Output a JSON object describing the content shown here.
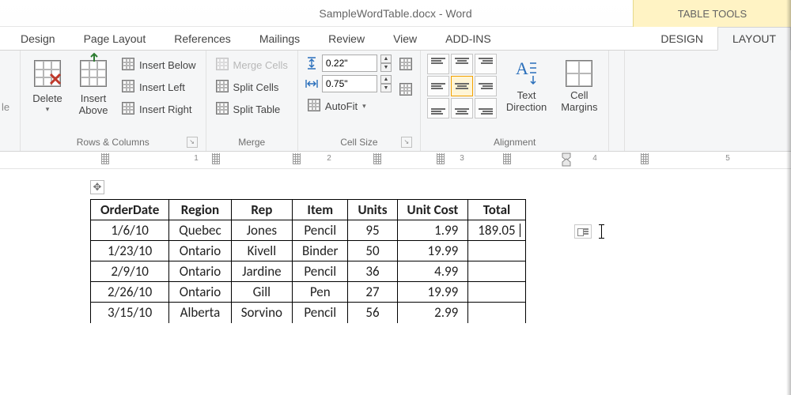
{
  "window": {
    "title": "SampleWordTable.docx - Word",
    "context_tool": "TABLE TOOLS"
  },
  "tabs": {
    "design": "Design",
    "page_layout": "Page Layout",
    "references": "References",
    "mailings": "Mailings",
    "review": "Review",
    "view": "View",
    "addins": "ADD-INS",
    "ctx_design": "DESIGN",
    "ctx_layout": "LAYOUT"
  },
  "ribbon": {
    "delete": "Delete",
    "insert_above": "Insert\nAbove",
    "insert_below": "Insert Below",
    "insert_left": "Insert Left",
    "insert_right": "Insert Right",
    "merge_cells": "Merge Cells",
    "split_cells": "Split Cells",
    "split_table": "Split Table",
    "autofit": "AutoFit",
    "text_direction": "Text\nDirection",
    "cell_margins": "Cell\nMargins",
    "group_rows_cols": "Rows & Columns",
    "group_merge": "Merge",
    "group_cell_size": "Cell Size",
    "group_alignment": "Alignment",
    "height_value": "0.22\"",
    "width_value": "0.75\""
  },
  "ruler": {
    "n1": "1",
    "n2": "2",
    "n3": "3",
    "n4": "4",
    "n5": "5"
  },
  "table": {
    "headers": {
      "c0": "OrderDate",
      "c1": "Region",
      "c2": "Rep",
      "c3": "Item",
      "c4": "Units",
      "c5": "Unit Cost",
      "c6": "Total"
    },
    "rows": [
      {
        "c0": "1/6/10",
        "c1": "Quebec",
        "c2": "Jones",
        "c3": "Pencil",
        "c4": "95",
        "c5": "1.99",
        "c6": "189.05"
      },
      {
        "c0": "1/23/10",
        "c1": "Ontario",
        "c2": "Kivell",
        "c3": "Binder",
        "c4": "50",
        "c5": "19.99",
        "c6": ""
      },
      {
        "c0": "2/9/10",
        "c1": "Ontario",
        "c2": "Jardine",
        "c3": "Pencil",
        "c4": "36",
        "c5": "4.99",
        "c6": ""
      },
      {
        "c0": "2/26/10",
        "c1": "Ontario",
        "c2": "Gill",
        "c3": "Pen",
        "c4": "27",
        "c5": "19.99",
        "c6": ""
      },
      {
        "c0": "3/15/10",
        "c1": "Alberta",
        "c2": "Sorvino",
        "c3": "Pencil",
        "c4": "56",
        "c5": "2.99",
        "c6": ""
      }
    ]
  }
}
